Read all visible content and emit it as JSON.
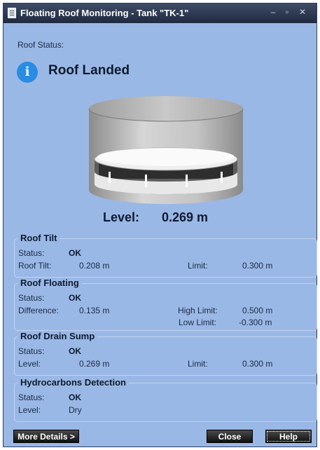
{
  "window": {
    "title": "Floating Roof Monitoring - Tank \"TK-1\"",
    "min_glyph": "–",
    "max_glyph": "▫",
    "close_glyph": "✕"
  },
  "roof_status": {
    "label": "Roof Status:",
    "icon_glyph": "i",
    "value": "Roof Landed"
  },
  "level": {
    "label": "Level:",
    "value": "0.269  m"
  },
  "groups": {
    "roof_tilt": {
      "title": "Roof Tilt",
      "status_label": "Status:",
      "status_value": "OK",
      "tilt_label": "Roof Tilt:",
      "tilt_value": "0.208 m",
      "limit_label": "Limit:",
      "limit_value": "0.300 m"
    },
    "roof_floating": {
      "title": "Roof Floating",
      "status_label": "Status:",
      "status_value": "OK",
      "diff_label": "Difference:",
      "diff_value": "0.135 m",
      "high_label": "High Limit:",
      "high_value": "0.500 m",
      "low_label": "Low Limit:",
      "low_value": "-0.300 m"
    },
    "roof_drain": {
      "title": "Roof Drain Sump",
      "status_label": "Status:",
      "status_value": "OK",
      "level_label": "Level:",
      "level_value": "0.269 m",
      "limit_label": "Limit:",
      "limit_value": "0.300 m"
    },
    "hydrocarbons": {
      "title": "Hydrocarbons Detection",
      "status_label": "Status:",
      "status_value": "OK",
      "level_label": "Level:",
      "level_value": "Dry"
    }
  },
  "buttons": {
    "more_details": "More Details >",
    "close": "Close",
    "help": "Help"
  }
}
